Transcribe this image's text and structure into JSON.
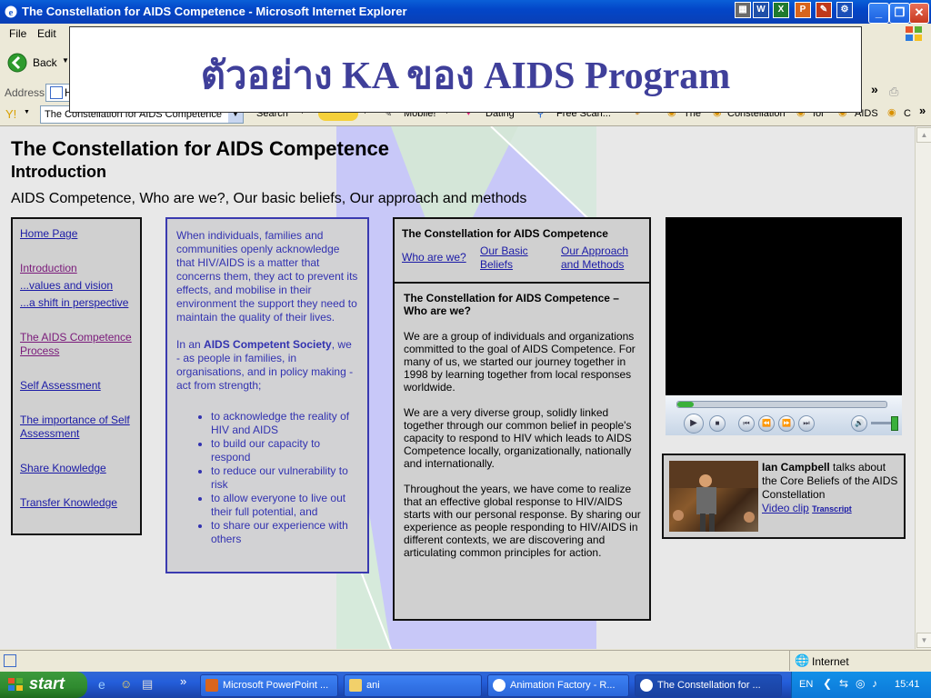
{
  "window": {
    "title": "The Constellation for AIDS Competence - Microsoft Internet Explorer",
    "app_icons": [
      "W",
      "X",
      "P"
    ]
  },
  "menu": {
    "items": [
      "File",
      "Edit"
    ]
  },
  "toolbar": {
    "back_label": "Back",
    "address_label": "Address",
    "address_value": "H"
  },
  "linksbar": {
    "dropdown_value": "The Constellation for AIDS Competence",
    "search_label": "Search",
    "mobile_label": "Mobile!",
    "dating_label": "Dating",
    "freescan_label": "Free Scan...",
    "words": [
      "The",
      "Constellation",
      "for",
      "AIDS",
      "C"
    ]
  },
  "overlay": {
    "text": "ตัวอย่าง KA ของ AIDS Program"
  },
  "page": {
    "heading": "The Constellation for AIDS Competence",
    "subheading": "Introduction",
    "subtitle": "AIDS Competence, Who are we?, Our basic beliefs, Our approach and methods"
  },
  "nav": {
    "items": [
      {
        "label": "Home Page"
      },
      {
        "label": "Introduction"
      },
      {
        "label": "...values and vision"
      },
      {
        "label": "...a shift in perspective"
      },
      {
        "label": "The AIDS Competence Process"
      },
      {
        "label": "Self Assessment"
      },
      {
        "label": "The importance of Self Assessment"
      },
      {
        "label": "Share Knowledge"
      },
      {
        "label": "Transfer Knowledge"
      }
    ]
  },
  "intro": {
    "para1": "When individuals, families and communities openly acknowledge that HIV/AIDS is a matter that concerns them, they act to prevent its effects, and mobilise in their environment the support they need to maintain the quality of their lives.",
    "para2_prefix": "In an ",
    "para2_bold": "AIDS Competent Society",
    "para2_suffix": ", we - as people in families, in organisations, and in policy making - act from strength;",
    "bullets": [
      "to acknowledge the reality of HIV and AIDS",
      "to build our capacity to respond",
      "to reduce our vulnerability to risk",
      "to allow everyone to live out their full potential, and",
      "to share our experience with others"
    ]
  },
  "center": {
    "header": "The Constellation for AIDS Competence",
    "link1": "Who are we?",
    "link2": "Our Basic Beliefs",
    "link3": "Our Approach and Methods",
    "section_title": "The Constellation for AIDS Competence – Who are we?",
    "p1": "We are a group of individuals and organizations committed to the goal of AIDS Competence. For many of us, we started our journey together in 1998 by learning together from local responses worldwide.",
    "p2": "We are a very diverse group, solidly linked together through our common belief in people's capacity to respond to HIV which leads to AIDS Competence locally, organizationally, nationally and internationally.",
    "p3": "Throughout the years, we have come to realize that an effective global response to HIV/AIDS starts with our personal response. By sharing our experience as people responding to HIV/AIDS in different contexts, we are discovering and articulating common principles for action."
  },
  "video": {
    "progress": 0.08,
    "volume": 0.9
  },
  "ian": {
    "name": "Ian Campbell",
    "desc": " talks about the Core Beliefs of the AIDS Constellation",
    "clip": "Video clip",
    "transcript": "Transcript"
  },
  "status": {
    "zone": "Internet"
  },
  "taskbar": {
    "start": "start",
    "tasks": [
      {
        "label": "Microsoft PowerPoint ..."
      },
      {
        "label": "ani"
      },
      {
        "label": "Animation Factory - R..."
      },
      {
        "label": "The Constellation for ..."
      }
    ],
    "lang": "EN",
    "clock": "15:41"
  },
  "colors": {
    "link": "#1a1aa6",
    "visited": "#7a1a7a",
    "overlay_text": "#3f3f9a",
    "intro_text": "#3232b0"
  }
}
